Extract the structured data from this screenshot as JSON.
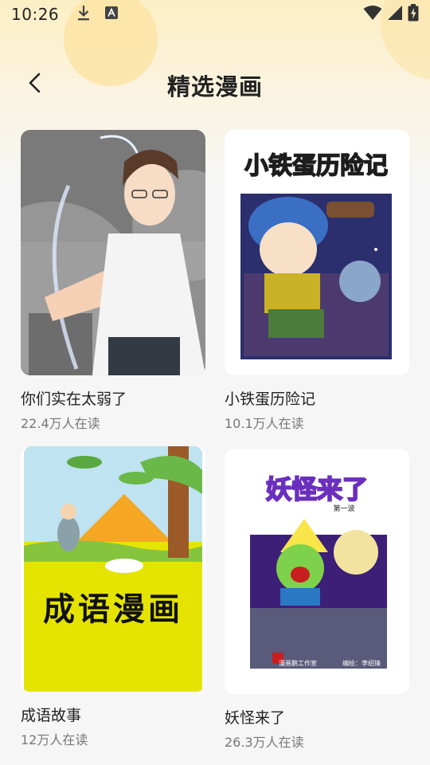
{
  "status_bar": {
    "time": "10:26",
    "left_icons": [
      "download-icon",
      "font-icon"
    ],
    "right_icons": [
      "wifi-icon",
      "signal-icon",
      "battery-charging-icon"
    ]
  },
  "header": {
    "title": "精选漫画",
    "back_icon": "chevron-left-icon"
  },
  "comics": [
    {
      "title": "你们实在太弱了",
      "readers": "22.4万人在读"
    },
    {
      "title": "小铁蛋历险记",
      "readers": "10.1万人在读",
      "cover_text": "小铁蛋历险记"
    },
    {
      "title": "成语故事",
      "readers": "12万人在读",
      "cover_text": "成语漫画"
    },
    {
      "title": "妖怪来了",
      "readers": "26.3万人在读",
      "cover_text": "妖怪来了",
      "cover_subtitle": "第一波",
      "cover_footer_left": "漫画鹅工作室",
      "cover_footer_right": "编绘：李绍锋"
    }
  ],
  "colors": {
    "header_gradient_top": "#fcefc4",
    "background": "#f6f6f6",
    "title_text": "#222222",
    "meta_text": "#777777"
  }
}
